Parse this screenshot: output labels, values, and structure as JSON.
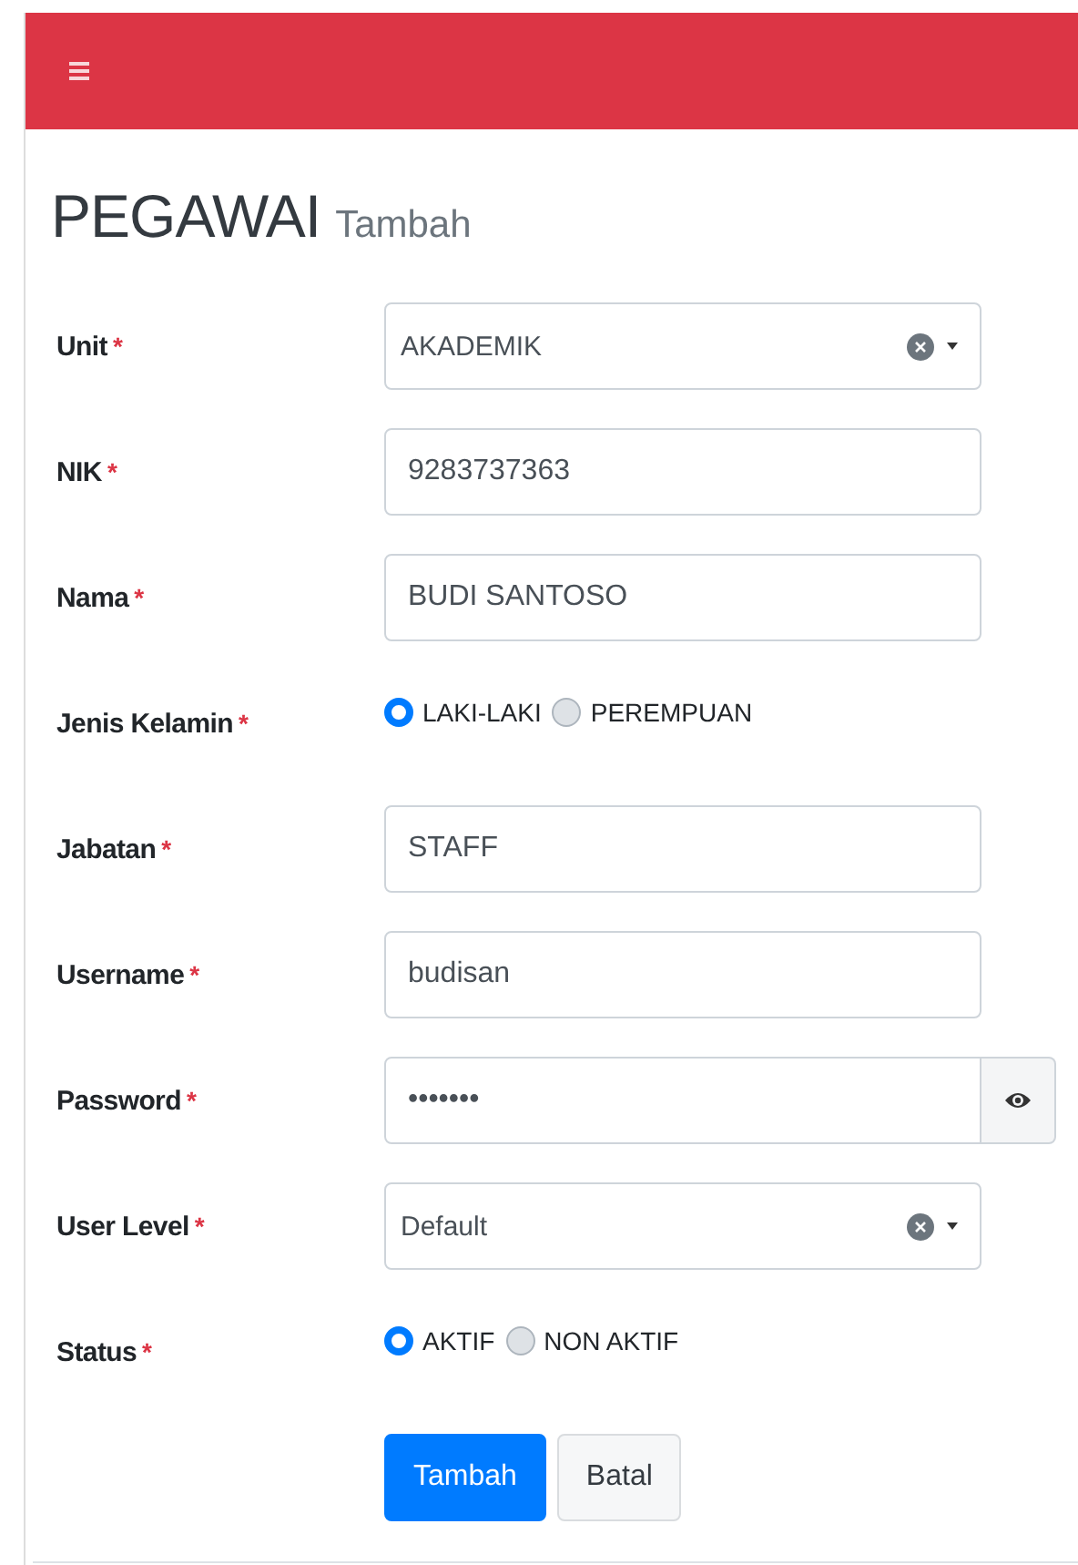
{
  "header": {
    "menu_button": true
  },
  "page": {
    "title": "PEGAWAI",
    "subtitle": "Tambah"
  },
  "required_mark": "*",
  "fields": [
    {
      "kind": "select",
      "label": "Unit",
      "required": true,
      "value": "AKADEMIK"
    },
    {
      "kind": "text",
      "label": "NIK",
      "required": true,
      "value": "9283737363"
    },
    {
      "kind": "text",
      "label": "Nama",
      "required": true,
      "value": "BUDI SANTOSO"
    },
    {
      "kind": "radio",
      "label": "Jenis Kelamin",
      "required": true,
      "options": [
        {
          "label": "LAKI-LAKI",
          "selected": true
        },
        {
          "label": "PEREMPUAN",
          "selected": false
        }
      ]
    },
    {
      "kind": "text",
      "label": "Jabatan",
      "required": true,
      "value": "STAFF"
    },
    {
      "kind": "text",
      "label": "Username",
      "required": true,
      "value": "budisan"
    },
    {
      "kind": "password",
      "label": "Password",
      "required": true,
      "value": "•••••••"
    },
    {
      "kind": "select",
      "label": "User Level",
      "required": true,
      "value": "Default"
    },
    {
      "kind": "radio",
      "label": "Status",
      "required": true,
      "options": [
        {
          "label": "AKTIF",
          "selected": true
        },
        {
          "label": "NON AKTIF",
          "selected": false
        }
      ]
    }
  ],
  "buttons": [
    {
      "kind": "primary",
      "label": "Tambah"
    },
    {
      "kind": "secondary",
      "label": "Batal"
    }
  ]
}
